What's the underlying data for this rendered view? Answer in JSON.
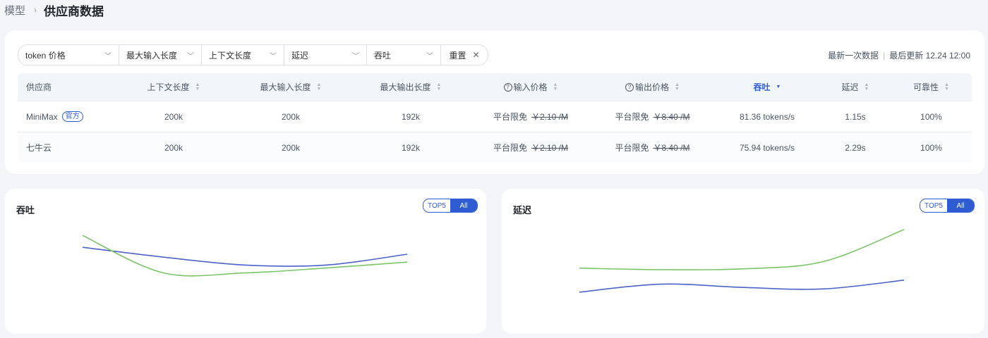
{
  "breadcrumb": {
    "parent": "模型",
    "current": "供应商数据"
  },
  "filters": {
    "items": [
      "token 价格",
      "最大输入长度",
      "上下文长度",
      "延迟",
      "吞吐"
    ],
    "reset": "重置"
  },
  "meta": {
    "left": "最新一次数据",
    "right": "最后更新 12.24 12:00"
  },
  "table": {
    "headers": [
      "供应商",
      "上下文长度",
      "最大输入长度",
      "最大输出长度",
      "输入价格",
      "输出价格",
      "吞吐",
      "延迟",
      "可靠性"
    ],
    "active_sort_column": "吞吐",
    "rows": [
      {
        "provider": "MiniMax",
        "badge": "官方",
        "context": "200k",
        "max_input": "200k",
        "max_output": "192k",
        "input_price_label": "平台限免",
        "input_price_orig": "￥2.10 /M",
        "output_price_label": "平台限免",
        "output_price_orig": "￥8.40 /M",
        "throughput": "81.36 tokens/s",
        "latency": "1.15s",
        "reliability": "100%"
      },
      {
        "provider": "七牛云",
        "badge": "",
        "context": "200k",
        "max_input": "200k",
        "max_output": "192k",
        "input_price_label": "平台限免",
        "input_price_orig": "￥2.10 /M",
        "output_price_label": "平台限免",
        "output_price_orig": "￥8.40 /M",
        "throughput": "75.94 tokens/s",
        "latency": "2.29s",
        "reliability": "100%"
      }
    ]
  },
  "colors": {
    "accent": "#2f5bd3",
    "series_blue": "#4a63c8",
    "series_green": "#7cc46a"
  },
  "toggle": {
    "top5": "TOP5",
    "all": "All",
    "selected": "All"
  },
  "chart_data": [
    {
      "type": "line",
      "title": "吞吐",
      "x": [
        0,
        1,
        2,
        3,
        4
      ],
      "series": [
        {
          "color": "#4a63c8",
          "values": [
            0.62,
            0.52,
            0.44,
            0.44,
            0.55
          ]
        },
        {
          "color": "#7cc46a",
          "values": [
            0.74,
            0.36,
            0.36,
            0.41,
            0.47
          ]
        }
      ],
      "ylim": [
        0,
        1
      ],
      "grid": false,
      "legend": "none"
    },
    {
      "type": "line",
      "title": "延迟",
      "x": [
        0,
        1,
        2,
        3,
        4
      ],
      "series": [
        {
          "color": "#7cc46a",
          "values": [
            0.52,
            0.5,
            0.51,
            0.6,
            1.0
          ]
        },
        {
          "color": "#4a63c8",
          "values": [
            0.22,
            0.32,
            0.28,
            0.26,
            0.37
          ]
        }
      ],
      "ylim": [
        0,
        1
      ],
      "grid": false,
      "legend": "none"
    }
  ]
}
